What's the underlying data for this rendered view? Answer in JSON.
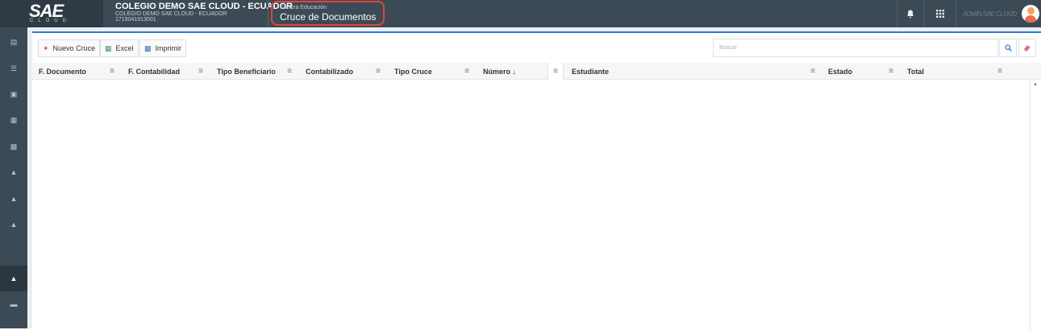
{
  "header": {
    "logo_text": "SAE",
    "logo_sub": "CLOUD",
    "org_name": "COLEGIO DEMO SAE CLOUD - ECUADOR",
    "org_sub": "COLEGIO DEMO SAE CLOUD - ECUADOR",
    "org_id": "1719041913001",
    "module_category": "Cartera Educación",
    "module_title": "Cruce de Documentos",
    "user_name": "ADMIN SAE CLOUD",
    "bell_icon": "bell-icon",
    "apps_icon": "apps-grid-icon"
  },
  "sidebar": {
    "items": [
      {
        "icon": "menu-icon"
      },
      {
        "icon": "menu-icon"
      },
      {
        "icon": "briefcase-icon"
      },
      {
        "icon": "id-card-icon"
      },
      {
        "icon": "building-icon"
      },
      {
        "icon": "graduation-cap-icon"
      },
      {
        "icon": "graduation-cap-icon"
      },
      {
        "icon": "graduation-cap-icon"
      },
      {
        "icon": "graduation-cap-icon",
        "active": true
      },
      {
        "icon": "truck-icon"
      }
    ]
  },
  "toolbar": {
    "new_label": "Nuevo Cruce",
    "excel_label": "Excel",
    "print_label": "Imprimir",
    "search_placeholder": "Buscar"
  },
  "grid": {
    "columns": [
      {
        "label": "F. Documento"
      },
      {
        "label": "F. Contabilidad"
      },
      {
        "label": "Tipo Beneficiario"
      },
      {
        "label": "Contabilizado"
      },
      {
        "label": "Tipo Cruce"
      },
      {
        "label": "Número ↓"
      },
      {
        "label": "Estudiante"
      },
      {
        "label": "Estado"
      },
      {
        "label": "Total"
      }
    ],
    "rows": []
  },
  "colors": {
    "topbar": "#3c4a55",
    "accent": "#2b7bd6",
    "highlight": "#e0463a"
  }
}
